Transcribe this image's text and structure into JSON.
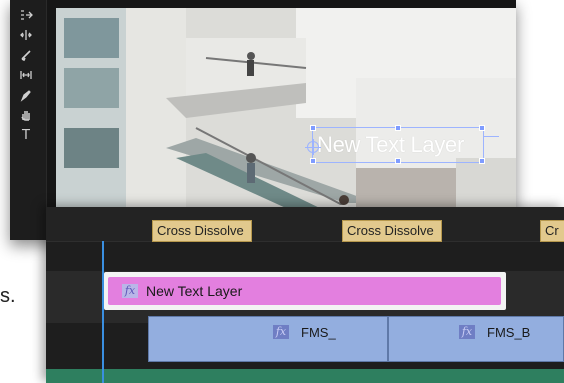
{
  "monitor": {
    "text_layer": "New Text Layer",
    "tools": [
      {
        "name": "track-select-icon",
        "glyph": ""
      },
      {
        "name": "ripple-edit-icon",
        "glyph": ""
      },
      {
        "name": "razor-icon",
        "glyph": ""
      },
      {
        "name": "slip-icon",
        "glyph": ""
      },
      {
        "name": "pen-icon",
        "glyph": ""
      },
      {
        "name": "hand-icon",
        "glyph": ""
      },
      {
        "name": "type-icon",
        "glyph": "T"
      }
    ]
  },
  "timeline": {
    "graphic_clip": "New Text Layer",
    "fx": "fx",
    "transitions": [
      "Cross Dissolve",
      "Cross Dissolve",
      "Cr"
    ],
    "clips": [
      "FMS_",
      "FMS_B"
    ]
  },
  "stray": "s."
}
